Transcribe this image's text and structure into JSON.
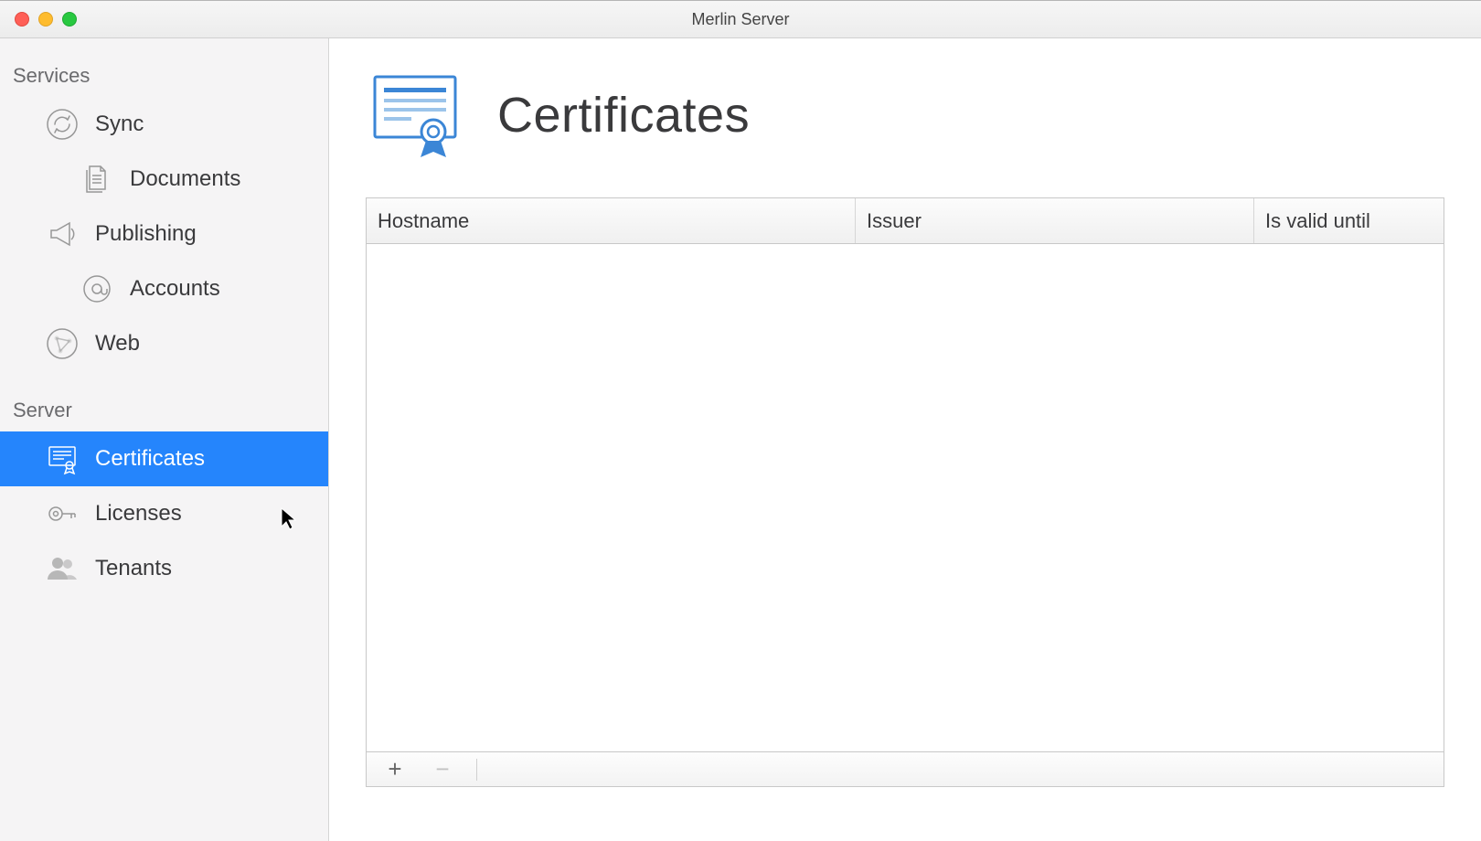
{
  "window": {
    "title": "Merlin Server"
  },
  "sidebar": {
    "sections": [
      {
        "header": "Services",
        "items": [
          {
            "label": "Sync"
          },
          {
            "label": "Documents"
          },
          {
            "label": "Publishing"
          },
          {
            "label": "Accounts"
          },
          {
            "label": "Web"
          }
        ]
      },
      {
        "header": "Server",
        "items": [
          {
            "label": "Certificates"
          },
          {
            "label": "Licenses"
          },
          {
            "label": "Tenants"
          }
        ]
      }
    ]
  },
  "main": {
    "title": "Certificates",
    "table": {
      "columns": [
        "Hostname",
        "Issuer",
        "Is valid until"
      ],
      "rows": []
    },
    "footer": {
      "add_label": "+",
      "remove_label": "−"
    }
  }
}
